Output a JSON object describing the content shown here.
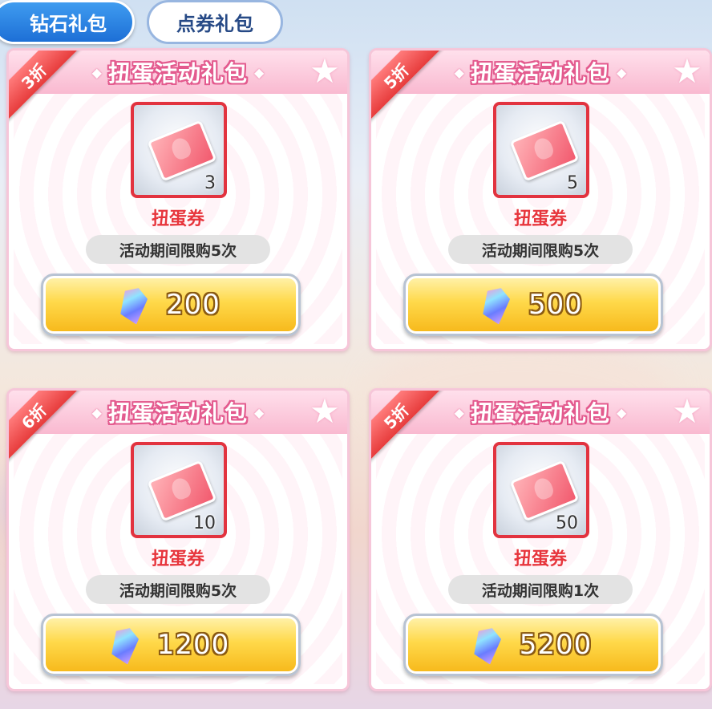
{
  "tabs": [
    {
      "label": "钻石礼包",
      "active": true
    },
    {
      "label": "点券礼包",
      "active": false
    }
  ],
  "cards": [
    {
      "title": "扭蛋活动礼包",
      "discount": "3折",
      "item_name": "扭蛋券",
      "item_count": "3",
      "limit": "活动期间限购5次",
      "price": "200"
    },
    {
      "title": "扭蛋活动礼包",
      "discount": "5折",
      "item_name": "扭蛋券",
      "item_count": "5",
      "limit": "活动期间限购5次",
      "price": "500"
    },
    {
      "title": "扭蛋活动礼包",
      "discount": "6折",
      "item_name": "扭蛋券",
      "item_count": "10",
      "limit": "活动期间限购5次",
      "price": "1200"
    },
    {
      "title": "扭蛋活动礼包",
      "discount": "5折",
      "item_name": "扭蛋券",
      "item_count": "50",
      "limit": "活动期间限购1次",
      "price": "5200"
    }
  ],
  "icons": {
    "item": "gacha-ticket-icon",
    "currency": "diamond-gem-icon",
    "decoration": "star-icon"
  },
  "colors": {
    "active_tab": "#1d6fd6",
    "ribbon": "#e73c3c",
    "item_name": "#e7353c",
    "header_pink": "#f9b9d0",
    "price_button": "#ffd94a"
  }
}
